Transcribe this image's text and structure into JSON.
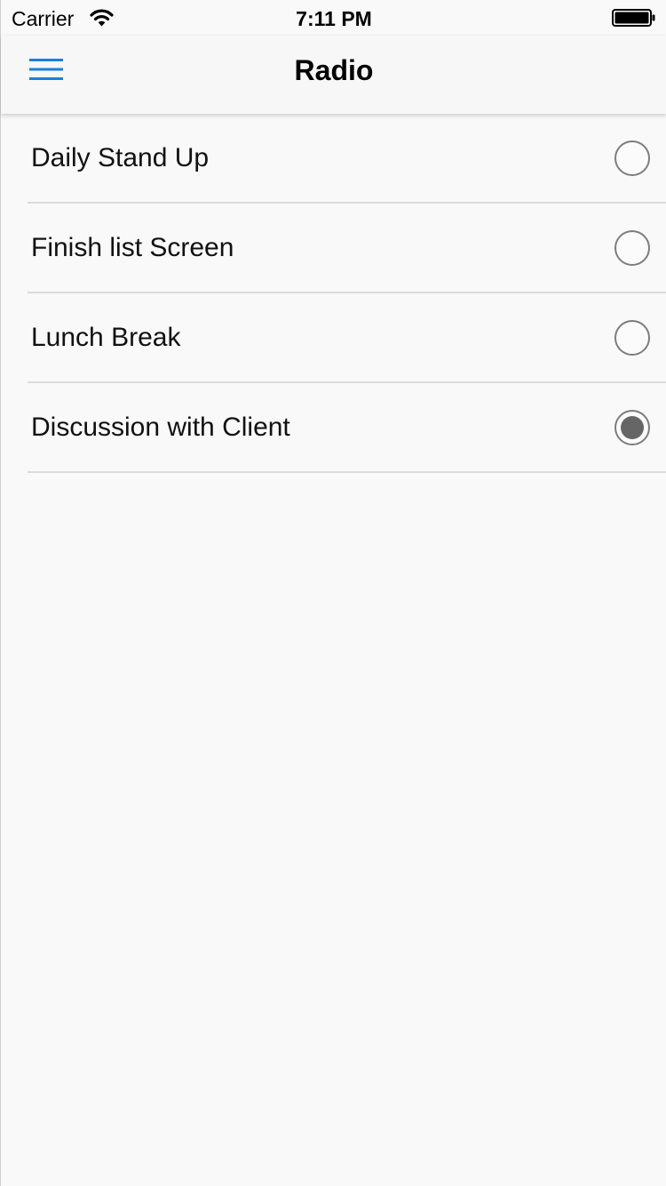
{
  "status_bar": {
    "carrier": "Carrier",
    "time": "7:11 PM",
    "wifi_icon": "wifi-icon",
    "battery_icon": "battery-icon"
  },
  "nav": {
    "title": "Radio",
    "menu_icon": "hamburger-menu-icon",
    "accent_color": "#1a7fe0"
  },
  "items": [
    {
      "label": "Daily Stand Up",
      "checked": false
    },
    {
      "label": "Finish list Screen",
      "checked": false
    },
    {
      "label": "Lunch Break",
      "checked": false
    },
    {
      "label": "Discussion with Client",
      "checked": true
    }
  ]
}
